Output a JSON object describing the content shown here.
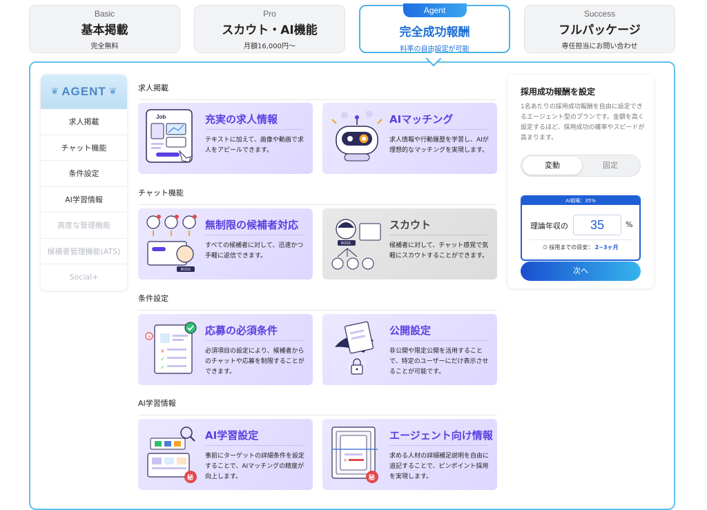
{
  "plans": [
    {
      "en": "Basic",
      "ja": "基本掲載",
      "sub": "完全無料"
    },
    {
      "en": "Pro",
      "ja": "スカウト・AI機能",
      "sub": "月額16,000円〜"
    },
    {
      "en": "Agent",
      "ja": "完全成功報酬",
      "sub": "料率の自由設定が可能"
    },
    {
      "en": "Success",
      "ja": "フルパッケージ",
      "sub": "専任担当にお問い合わせ"
    }
  ],
  "sidebar": {
    "logo": "AGENT",
    "items": [
      {
        "label": "求人掲載"
      },
      {
        "label": "チャット機能"
      },
      {
        "label": "条件設定"
      },
      {
        "label": "AI学習情報"
      },
      {
        "label": "高度な管理機能"
      },
      {
        "label": "候補者管理機能(ATS)"
      },
      {
        "label": "Social+"
      }
    ]
  },
  "sections": [
    {
      "title": "求人掲載",
      "cards": [
        {
          "title": "充実の求人情報",
          "desc": "テキストに加えて、画像や動画で求人をアピールできます。"
        },
        {
          "title": "AIマッチング",
          "desc": "求人情報や行動履歴を学習し、AIが理想的なマッチングを実現します。"
        }
      ]
    },
    {
      "title": "チャット機能",
      "cards": [
        {
          "title": "無制限の候補者対応",
          "desc": "すべての候補者に対して、迅速かつ手軽に返信できます。"
        },
        {
          "title": "スカウト",
          "desc": "候補者に対して、チャット感覚で気軽にスカウトすることができます。"
        }
      ]
    },
    {
      "title": "条件設定",
      "cards": [
        {
          "title": "応募の必須条件",
          "desc": "必須項目の設定により、候補者からのチャットや応募を制限することができます。"
        },
        {
          "title": "公開設定",
          "desc": "非公開や限定公開を活用することで、特定のユーザーにだけ表示させることが可能です。"
        }
      ]
    },
    {
      "title": "AI学習情報",
      "cards": [
        {
          "title": "AI学習設定",
          "desc": "事前にターゲットの詳細条件を設定することで、AIマッチングの精度が向上します。"
        },
        {
          "title": "エージェント向け情報",
          "desc": "求める人材の詳細補足説明を自由に追記することで、ピンポイント採用を実現します。"
        }
      ]
    }
  ],
  "illus_text": {
    "job": "Job",
    "boss": "BOSS",
    "secret": "秘"
  },
  "settings": {
    "title": "採用成功報酬を設定",
    "desc": "1名あたりの採用成功報酬を自由に設定できるエージェント型のプランです。金額を高く設定するほど、採用成功の確率やスピードが高まります。",
    "toggle_on": "変動",
    "toggle_off": "固定",
    "market": "AI相場：35%",
    "label": "理論年収の",
    "value": "35",
    "unit": "%",
    "eta_label": "採用までの目安：",
    "eta_value": "2~3ヶ月",
    "next": "次へ"
  },
  "colors": {
    "accent": "#1f5fd6",
    "card_purple": "#ddd7ff",
    "tab_border": "#4bb3e6"
  }
}
